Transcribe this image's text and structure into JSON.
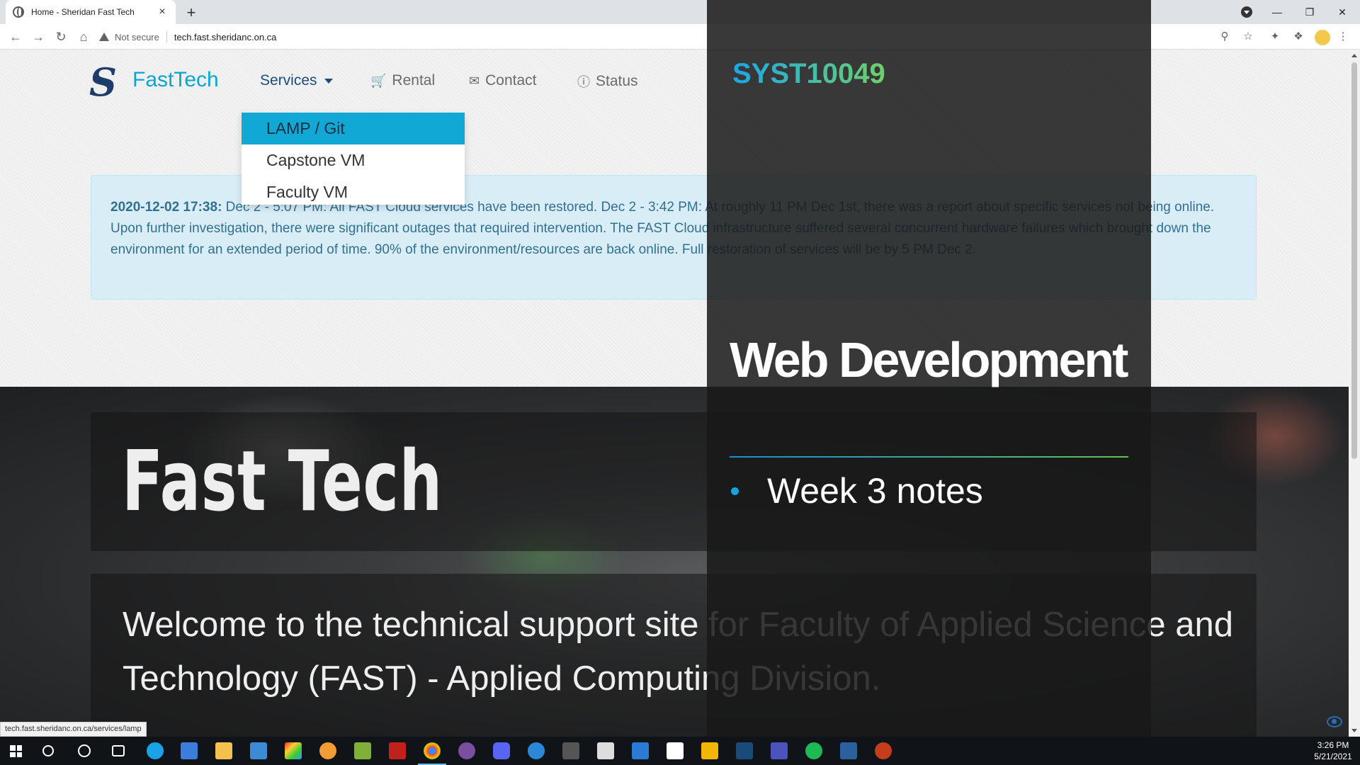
{
  "browser": {
    "tab_title": "Home - Sheridan Fast Tech",
    "tab_close": "×",
    "new_tab": "+",
    "security_label": "Not secure",
    "url": "tech.fast.sheridanc.on.ca"
  },
  "nav": {
    "brand_logo": "S",
    "brand": "FastTech",
    "items": [
      {
        "label": "Services",
        "icon": "caret-down"
      },
      {
        "label": "Rental",
        "icon": "cart-icon"
      },
      {
        "label": "Contact",
        "icon": "envelope-icon"
      },
      {
        "label": "Status",
        "icon": "info-icon"
      }
    ]
  },
  "dropdown": {
    "items": [
      "LAMP / Git",
      "Capstone VM",
      "Faculty VM"
    ],
    "selected": "LAMP / Git"
  },
  "alert": {
    "timestamp": "2020-12-02 17:38:",
    "message": "Dec 2 - 5:07 PM: All FAST Cloud services have been restored. Dec 2 - 3:42 PM: At roughly 11 PM Dec 1st, there was a report about specific services not being online. Upon further investigation, there were significant outages that required intervention. The FAST Cloud infrastructure suffered several concurrent hardware failures which brought down the environment for an extended period of time. 90% of the environment/resources are back online. Full restoration of services will be by 5 PM Dec 2."
  },
  "hero": {
    "title": "Fast Tech",
    "body": "Welcome to the technical support site for Faculty of Applied Science and Technology (FAST) - Applied Computing Division."
  },
  "status_bar_url": "tech.fast.sheridanc.on.ca/services/lamp",
  "slide": {
    "course_code": "SYST10049",
    "title": "Web Development",
    "bullet": "Week 3 notes"
  },
  "taskbar": {
    "time": "3:26 PM",
    "date": "5/21/2021"
  },
  "colors": {
    "accent": "#0ba5d0",
    "dropdown_selected": "#11a8d6",
    "alert_bg": "#d9edf7",
    "alert_text": "#31708f",
    "slide_bg": "#181818"
  }
}
